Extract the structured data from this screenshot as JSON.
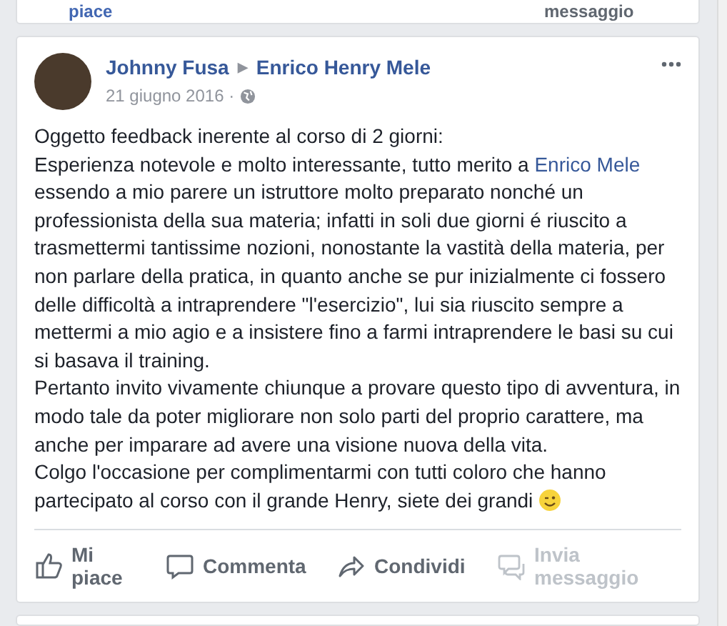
{
  "previous_post": {
    "actions": [
      {
        "label": "piace",
        "kind": "like"
      },
      {
        "label": "messaggio",
        "kind": "message"
      }
    ]
  },
  "post": {
    "author": "Johnny Fusa",
    "separator": "▶",
    "target": "Enrico Henry Mele",
    "date": "21 giugno 2016 ·",
    "paragraphs": [
      {
        "before": "Oggetto feedback inerente al corso di 2 giorni:"
      },
      {
        "before": "Esperienza notevole e molto interessante, tutto merito a ",
        "link": "Enrico Mele",
        "after": " essendo a mio parere un istruttore molto preparato nonché un professionista della sua materia; infatti in soli due giorni é riuscito a trasmettermi tantissime nozioni, nonostante la vastità della materia, per non parlare della pratica, in quanto anche se pur inizialmente ci fossero delle difficoltà a intraprendere \"l'esercizio\", lui sia riuscito sempre a mettermi a mio agio e a insistere fino a farmi intraprendere le basi su cui si basava il training."
      },
      {
        "before": "Pertanto invito vivamente chiunque a provare questo tipo di avventura, in modo tale da poter migliorare non solo parti del proprio carattere, ma anche per imparare ad avere una visione nuova della vita."
      },
      {
        "before": "Colgo l'occasione per complimentarmi con tutti coloro che hanno partecipato al corso con il grande Henry, siete dei grandi",
        "emoji": true
      }
    ],
    "actions": [
      {
        "kind": "like",
        "label": "Mi piace",
        "disabled": false
      },
      {
        "kind": "comment",
        "label": "Commenta",
        "disabled": false
      },
      {
        "kind": "share",
        "label": "Condividi",
        "disabled": false
      },
      {
        "kind": "message",
        "label": "Invia messaggio",
        "disabled": true
      }
    ]
  }
}
